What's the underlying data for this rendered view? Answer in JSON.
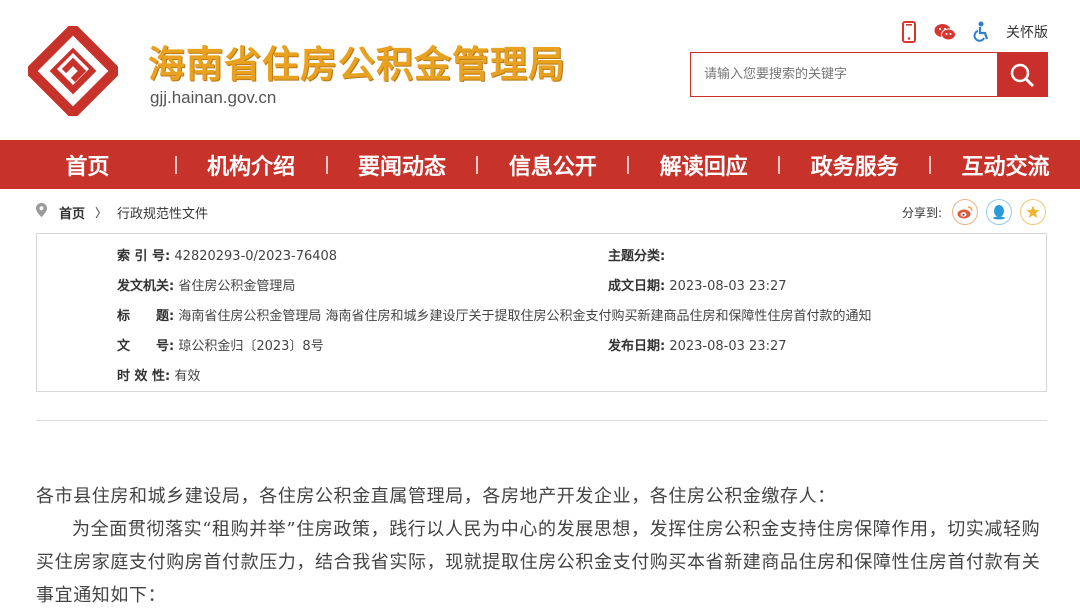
{
  "header": {
    "site_title": "海南省住房公积金管理局",
    "site_domain": "gjj.hainan.gov.cn",
    "care_label": "关怀版",
    "search_placeholder": "请输入您要搜索的关键字",
    "brand_color": "#c7322b",
    "title_color": "#e8a21f"
  },
  "nav": {
    "items": [
      {
        "label": "首页"
      },
      {
        "label": "机构介绍"
      },
      {
        "label": "要闻动态"
      },
      {
        "label": "信息公开"
      },
      {
        "label": "解读回应"
      },
      {
        "label": "政务服务"
      },
      {
        "label": "互动交流"
      }
    ]
  },
  "breadcrumb": {
    "home": "首页",
    "arrow": "〉",
    "current": "行政规范性文件"
  },
  "share": {
    "label": "分享到:"
  },
  "info": {
    "index_key": "索 引 号:",
    "index_val": "42820293-0/2023-76408",
    "topic_key": "主题分类:",
    "topic_val": "",
    "issuer_key": "发文机关:",
    "issuer_val": "省住房公积金管理局",
    "created_key": "成文日期:",
    "created_val": "2023-08-03 23:27",
    "title_key": "标　　题:",
    "title_val": "海南省住房公积金管理局 海南省住房和城乡建设厅关于提取住房公积金支付购买新建商品住房和保障性住房首付款的通知",
    "docno_key": "文　　号:",
    "docno_val": "琼公积金归〔2023〕8号",
    "published_key": "发布日期:",
    "published_val": "2023-08-03 23:27",
    "validity_key": "时 效 性:",
    "validity_val": "有效"
  },
  "content": {
    "salutation": "各市县住房和城乡建设局，各住房公积金直属管理局，各房地产开发企业，各住房公积金缴存人：",
    "paragraph1": "为全面贯彻落实“租购并举”住房政策，践行以人民为中心的发展思想，发挥住房公积金支持住房保障作用，切实减轻购买住房家庭支付购房首付款压力，结合我省实际，现就提取住房公积金支付购买本省新建商品住房和保障性住房首付款有关事宜通知如下："
  }
}
